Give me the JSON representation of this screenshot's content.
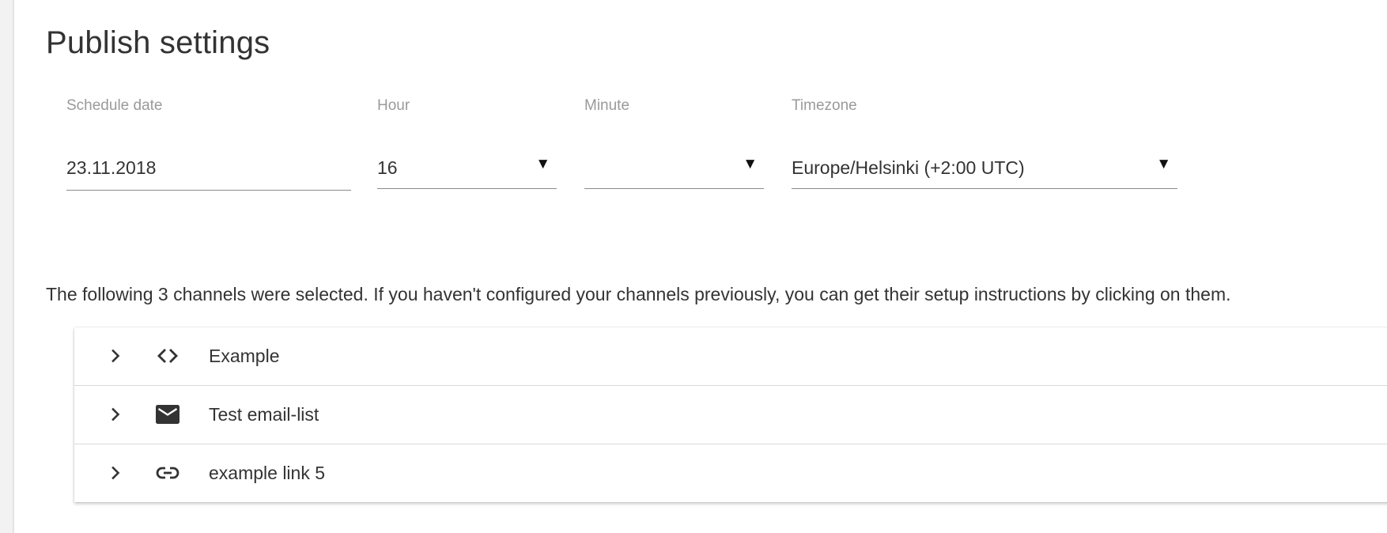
{
  "page": {
    "title": "Publish settings"
  },
  "schedule": {
    "date": {
      "label": "Schedule date",
      "value": "23.11.2018"
    },
    "hour": {
      "label": "Hour",
      "value": "16"
    },
    "minute": {
      "label": "Minute",
      "value": ""
    },
    "timezone": {
      "label": "Timezone",
      "value": "Europe/Helsinki (+2:00 UTC)"
    },
    "dropdown_glyph": "▼"
  },
  "channels": {
    "info": "The following 3 channels were selected. If you haven't configured your channels previously, you can get their setup instructions by clicking on them.",
    "items": [
      {
        "name": "Example",
        "icon": "code-icon"
      },
      {
        "name": "Test email-list",
        "icon": "email-icon"
      },
      {
        "name": "example link 5",
        "icon": "link-icon"
      }
    ]
  },
  "colors": {
    "text": "#333333",
    "label": "#9a9a9a",
    "underline": "#8a8a8a",
    "divider": "#d9d9d9",
    "background": "#ffffff"
  }
}
